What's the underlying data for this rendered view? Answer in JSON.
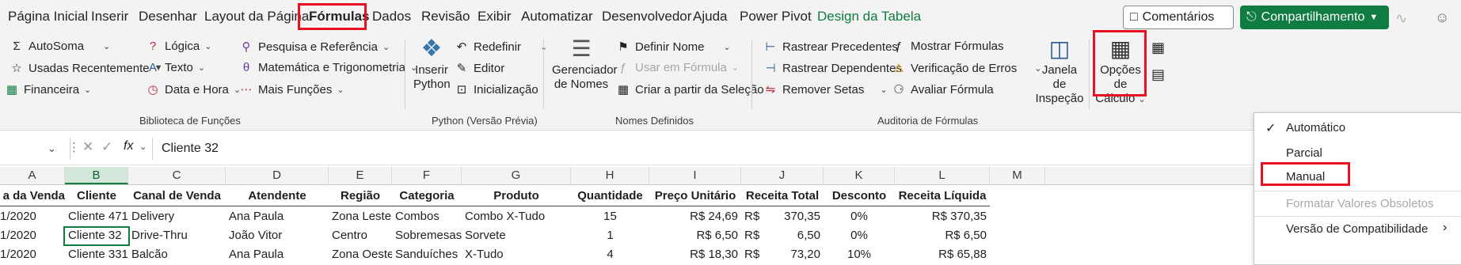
{
  "menu": {
    "tabs": [
      "Página Inicial",
      "Inserir",
      "Desenhar",
      "Layout da Página",
      "Fórmulas",
      "Dados",
      "Revisão",
      "Exibir",
      "Automatizar",
      "Desenvolvedor",
      "Ajuda",
      "Power Pivot",
      "Design da Tabela"
    ],
    "active_tab": "Fórmulas",
    "comments": "Comentários",
    "share": "Compartilhamento"
  },
  "ribbon": {
    "biblioteca": {
      "autosoma": "AutoSoma",
      "usadas": "Usadas Recentemente",
      "financeira": "Financeira",
      "logica": "Lógica",
      "texto": "Texto",
      "data_hora": "Data e Hora",
      "pesquisa": "Pesquisa e Referência",
      "matematica": "Matemática e Trigonometria",
      "mais": "Mais Funções",
      "label": "Biblioteca de Funções"
    },
    "python": {
      "inserir_1": "Inserir",
      "inserir_2": "Python",
      "redefinir": "Redefinir",
      "editor": "Editor",
      "inicializacao": "Inicialização",
      "label": "Python (Versão Prévia)"
    },
    "nomes": {
      "gerenciador_1": "Gerenciador",
      "gerenciador_2": "de Nomes",
      "definir": "Definir Nome",
      "usar": "Usar em Fórmula",
      "criar": "Criar a partir da Seleção",
      "label": "Nomes Definidos"
    },
    "auditoria": {
      "precedentes": "Rastrear Precedentes",
      "dependentes": "Rastrear Dependentes",
      "remover": "Remover Setas",
      "mostrar": "Mostrar Fórmulas",
      "verificacao": "Verificação de Erros",
      "avaliar": "Avaliar Fórmula",
      "janela_1": "Janela de",
      "janela_2": "Inspeção",
      "label": "Auditoria de Fórmulas"
    },
    "calculo": {
      "opcoes_1": "Opções de",
      "opcoes_2": "Cálculo"
    }
  },
  "formula_bar": {
    "fx": "fx",
    "content": "Cliente 32"
  },
  "columns": [
    "A",
    "B",
    "C",
    "D",
    "E",
    "F",
    "G",
    "H",
    "I",
    "J",
    "K",
    "L",
    "M"
  ],
  "headers": [
    "a da Venda",
    "Cliente",
    "Canal de Venda",
    "Atendente",
    "Região",
    "Categoria",
    "Produto",
    "Quantidade",
    "Preço Unitário",
    "Receita Total",
    "Desconto",
    "Receita Líquida"
  ],
  "rows": [
    [
      "1/2020",
      "Cliente 471",
      "Delivery",
      "Ana Paula",
      "Zona Leste",
      "Combos",
      "Combo X-Tudo",
      "15",
      "R$ 24,69",
      "R$",
      "370,35",
      "0%",
      "R$ 370,35"
    ],
    [
      "1/2020",
      "Cliente 32",
      "Drive-Thru",
      "João Vitor",
      "Centro",
      "Sobremesas",
      "Sorvete",
      "1",
      "R$ 6,50",
      "R$",
      "6,50",
      "0%",
      "R$ 6,50"
    ],
    [
      "1/2020",
      "Cliente 331",
      "Balcão",
      "Ana Paula",
      "Zona Oeste",
      "Sanduíches",
      "X-Tudo",
      "4",
      "R$ 18,30",
      "R$",
      "73,20",
      "10%",
      "R$ 65,88"
    ]
  ],
  "dropdown": {
    "automatico": "Automático",
    "parcial": "Parcial",
    "manual": "Manual",
    "formatar": "Formatar Valores Obsoletos",
    "versao": "Versão de Compatibilidade"
  },
  "colors": {
    "accent": "#107c41",
    "highlight": "#e81123"
  }
}
